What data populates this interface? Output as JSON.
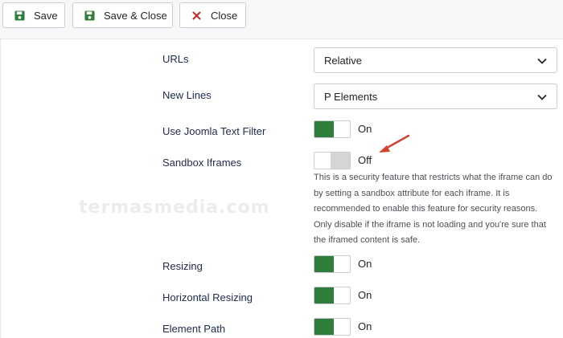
{
  "toolbar": {
    "save_label": "Save",
    "save_close_label": "Save & Close",
    "close_label": "Close",
    "save_icon": "floppy-disk-icon",
    "close_icon": "x-icon",
    "accent_icon_color": "#2f7d3a",
    "close_icon_color": "#c52827"
  },
  "fields": {
    "urls": {
      "label": "URLs",
      "value": "Relative"
    },
    "new_lines": {
      "label": "New Lines",
      "value": "P Elements"
    },
    "text_filter": {
      "label": "Use Joomla Text Filter",
      "state": "On"
    },
    "sandbox": {
      "label": "Sandbox Iframes",
      "state": "Off",
      "description": "This is a security feature that restricts what the iframe can do by setting a sandbox attribute for each iframe. It is recommended to enable this feature for security reasons. Only disable if the iframe is not loading and you're sure that the iframed content is safe."
    },
    "resizing": {
      "label": "Resizing",
      "state": "On"
    },
    "horizontal_resizing": {
      "label": "Horizontal Resizing",
      "state": "On"
    },
    "element_path": {
      "label": "Element Path",
      "state": "On"
    }
  },
  "colors": {
    "switch_on": "#2f7d3a",
    "switch_off": "#d4d5d7",
    "annotation_arrow": "#d0452f"
  },
  "watermark": "termasmedia.com"
}
